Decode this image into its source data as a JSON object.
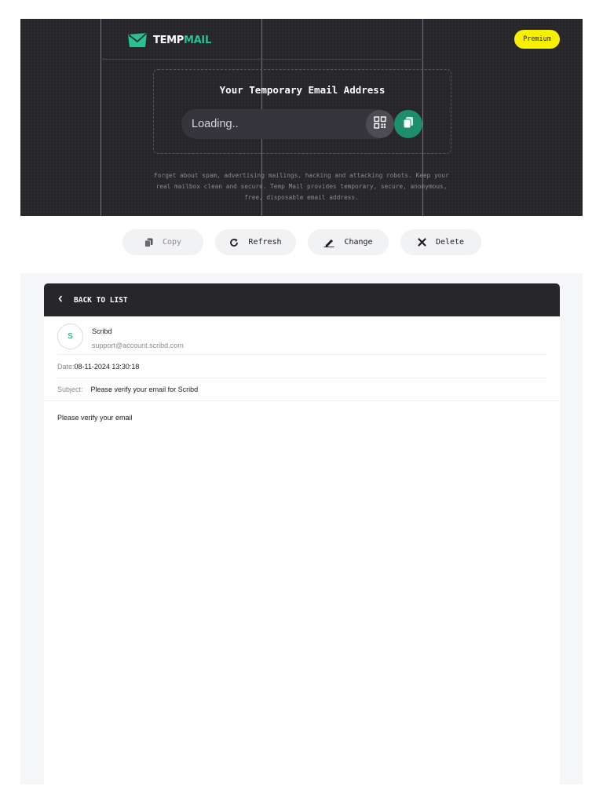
{
  "header": {
    "logo_temp": "TEMP",
    "logo_mail": "MAIL",
    "premium_label": "Premium",
    "title": "Your Temporary Email Address",
    "email_value": "Loading..",
    "description": "Forget about spam, advertising mailings, hacking and attacking robots. Keep your real mailbox clean and secure. Temp Mail provides temporary, secure, anonymous, free, disposable email address."
  },
  "actions": {
    "copy_label": "Copy",
    "refresh_label": "Refresh",
    "change_label": "Change",
    "delete_label": "Delete"
  },
  "message": {
    "back_label": "BACK TO LIST",
    "avatar_initial": "S",
    "sender_name": "Scribd",
    "sender_email": "support@account.scribd.com",
    "date_label": "Date:",
    "date_value": "08-11-2024 13:30:18",
    "subject_label": "Subject:",
    "subject_value": "Please verify your email for Scribd",
    "body": "Please verify your email"
  },
  "colors": {
    "accent": "#27c28f",
    "premium": "#f7f000",
    "dark": "#26262b"
  },
  "icons": [
    "envelope-logo-icon",
    "qr-code-icon",
    "copy-icon",
    "refresh-icon",
    "edit-pen-icon",
    "close-x-icon",
    "chevron-left-icon"
  ]
}
